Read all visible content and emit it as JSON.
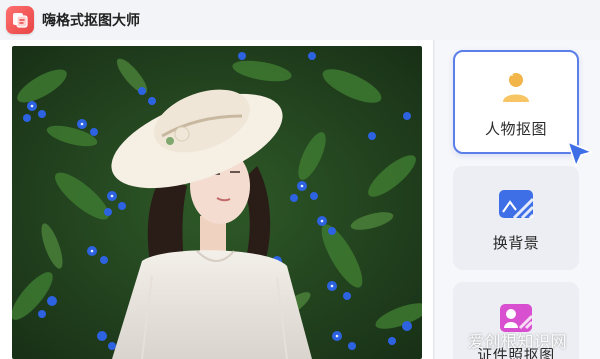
{
  "app": {
    "title": "嗨格式抠图大师",
    "logo_icon": "sticker-cutout-icon",
    "brand_color": "#e84545"
  },
  "tools": [
    {
      "label": "人物抠图",
      "icon": "person-cutout-icon",
      "active": true
    },
    {
      "label": "换背景",
      "icon": "change-background-icon",
      "active": false
    },
    {
      "label": "证件照抠图",
      "icon": "id-photo-icon",
      "active": false
    }
  ],
  "accent_color": "#5b7ee8",
  "watermark": {
    "text": "爱创根知识网"
  }
}
